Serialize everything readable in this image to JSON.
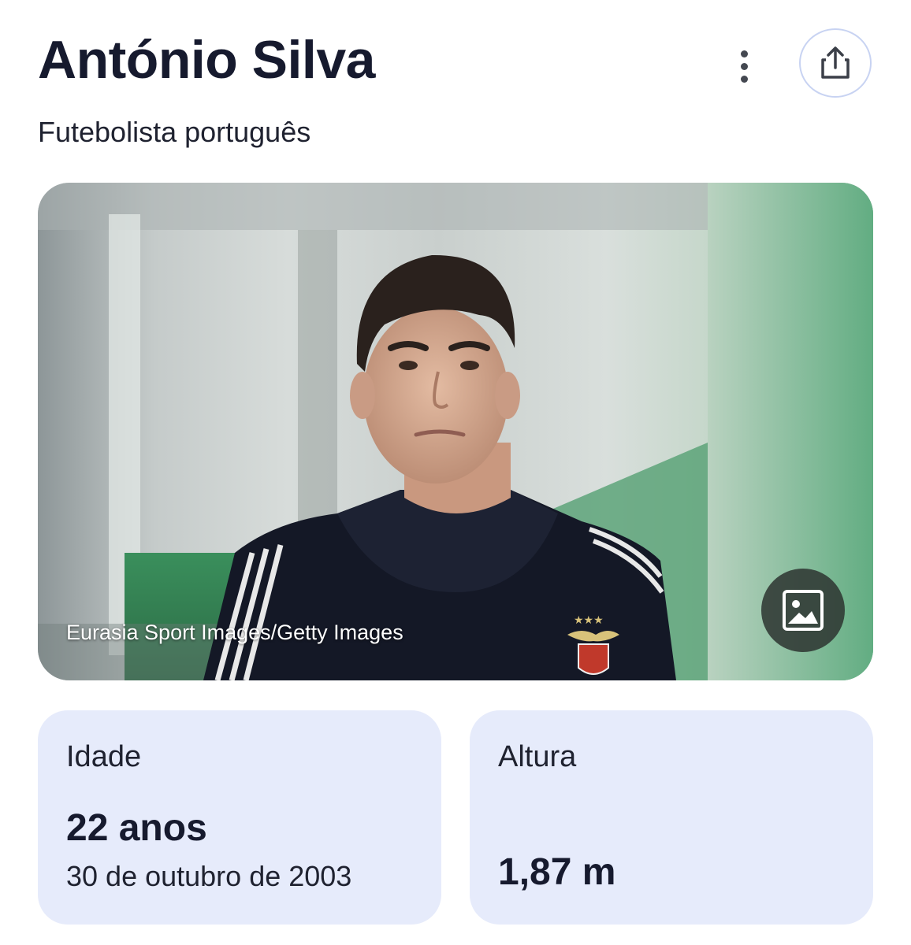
{
  "entity": {
    "name": "António Silva",
    "description": "Futebolista português"
  },
  "actions": {
    "more_icon": "more-vert-icon",
    "share_icon": "share-icon"
  },
  "image": {
    "credit": "Eurasia Sport Images/Getty Images",
    "gallery_icon": "image-icon"
  },
  "facts": {
    "age": {
      "label": "Idade",
      "value": "22 anos",
      "detail": "30 de outubro de 2003"
    },
    "height": {
      "label": "Altura",
      "value": "1,87 m"
    }
  },
  "colors": {
    "card_bg": "#e6ebfb",
    "share_border": "#c8d3f2",
    "title": "#161a2e"
  }
}
